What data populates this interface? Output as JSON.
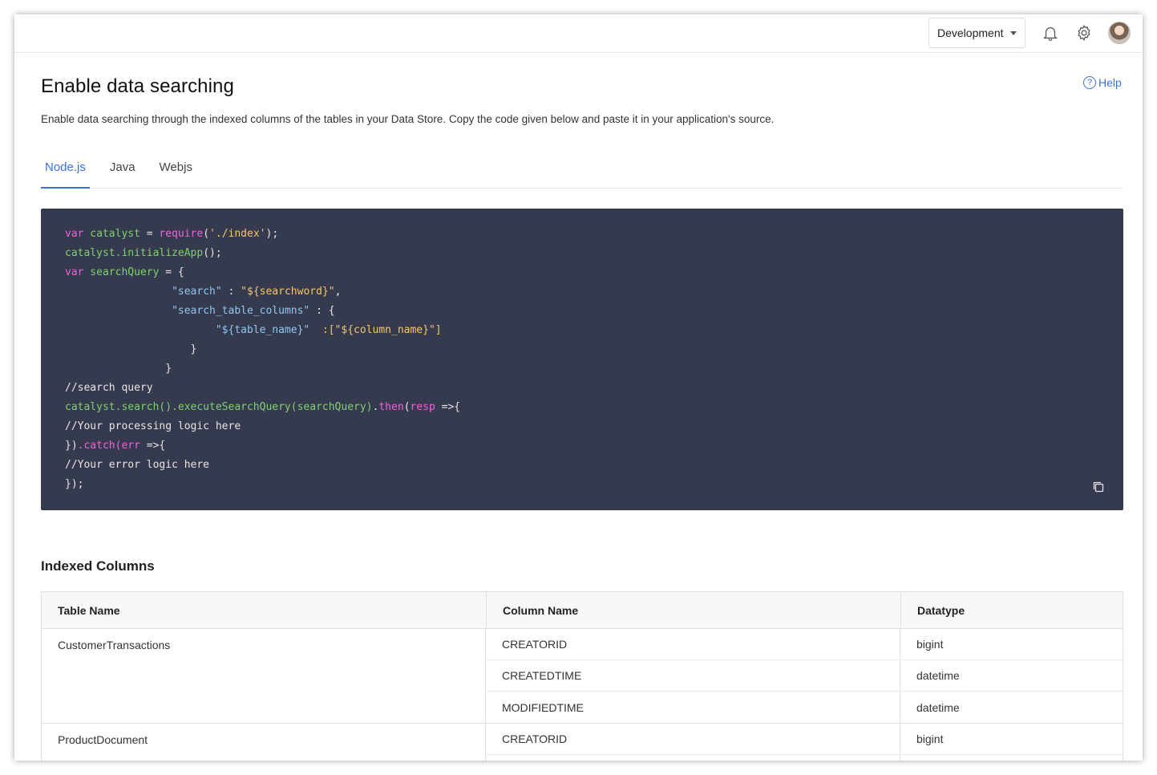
{
  "header": {
    "environment": "Development",
    "icons": [
      "bell-icon",
      "gear-icon",
      "avatar"
    ]
  },
  "page": {
    "title": "Enable data searching",
    "help": "Help",
    "description": "Enable data searching through the indexed columns of the tables in your Data Store. Copy the code given below and paste it in your application's source."
  },
  "tabs": [
    {
      "label": "Node.js",
      "active": true
    },
    {
      "label": "Java",
      "active": false
    },
    {
      "label": "Webjs",
      "active": false
    }
  ],
  "code": {
    "l1_kw": "var",
    "l1_name": " catalyst",
    "l1_eq": " = ",
    "l1_req": "require",
    "l1_open": "(",
    "l1_str": "'./index'",
    "l1_close": ");",
    "l2_fn": "catalyst.initializeApp",
    "l2_rest": "();",
    "l3_kw": "var",
    "l3_name": " searchQuery",
    "l3_rest": " = {",
    "l4_indent": "                 ",
    "l4_key": "\"search\"",
    "l4_colon": " : ",
    "l4_str": "\"${searchword}\"",
    "l4_comma": ",",
    "l5_indent": "                 ",
    "l5_key": "\"search_table_columns\"",
    "l5_rest": " : {",
    "l6_indent": "                        ",
    "l6_key": "\"${table_name}\"",
    "l6_colon": "  :",
    "l6_str": "[\"${column_name}\"]",
    "l7": "                    }",
    "l8": "                }",
    "l9": "//search query",
    "l10_fn": "catalyst.search().executeSearchQuery(searchQuery)",
    "l10_dot": ".",
    "l10_then": "then",
    "l10_open": "(",
    "l10_resp": "resp",
    "l10_rest": " =>{",
    "l11": "//Your processing logic here",
    "l12_a": "})",
    "l12_catch": ".catch(",
    "l12_err": "err",
    "l12_rest": " =>{",
    "l13": "//Your error logic here",
    "l14": "});"
  },
  "indexed": {
    "title": "Indexed Columns",
    "headers": [
      "Table Name",
      "Column Name",
      "Datatype"
    ],
    "groups": [
      {
        "table": "CustomerTransactions",
        "rows": [
          {
            "column": "CREATORID",
            "type": "bigint"
          },
          {
            "column": "CREATEDTIME",
            "type": "datetime"
          },
          {
            "column": "MODIFIEDTIME",
            "type": "datetime"
          }
        ]
      },
      {
        "table": "ProductDocument",
        "rows": [
          {
            "column": "CREATORID",
            "type": "bigint"
          },
          {
            "column": "",
            "type": ""
          }
        ]
      }
    ]
  }
}
